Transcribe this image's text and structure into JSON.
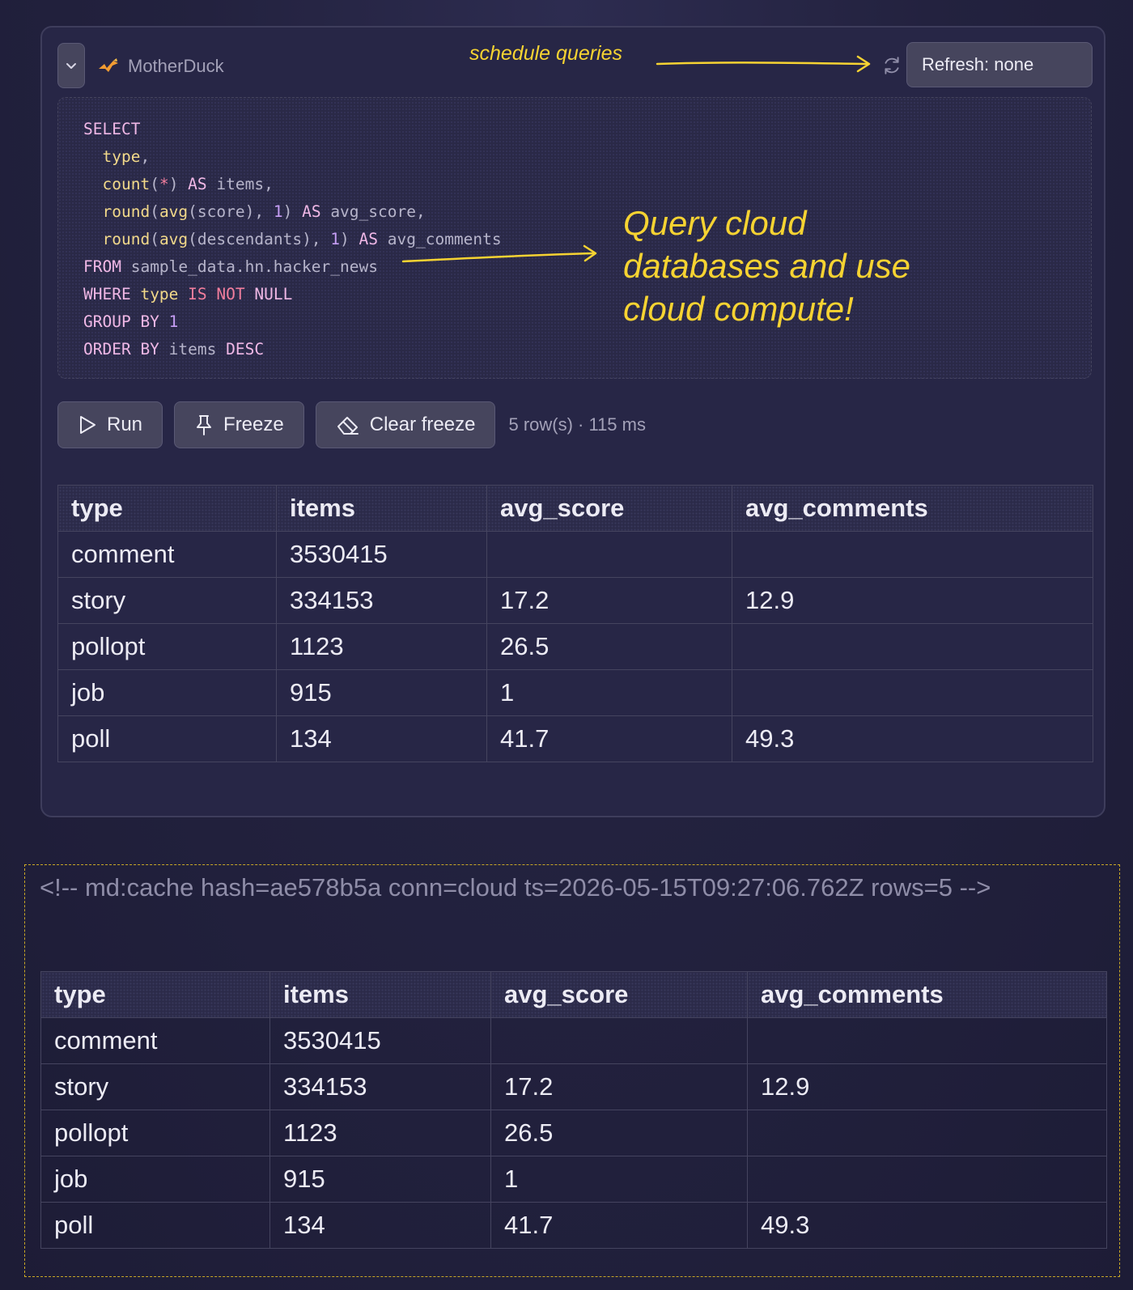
{
  "header": {
    "connection_name": "MotherDuck",
    "refresh_label": "Refresh: none",
    "annotation_schedule": "schedule queries"
  },
  "annotation_cloud": {
    "lines": [
      "Query cloud",
      "databases and use",
      "cloud compute!"
    ]
  },
  "toolbar": {
    "run_label": "Run",
    "freeze_label": "Freeze",
    "clear_freeze_label": "Clear freeze",
    "status": "5 row(s) · 115 ms"
  },
  "results": {
    "columns": [
      "type",
      "items",
      "avg_score",
      "avg_comments"
    ],
    "rows": [
      [
        "comment",
        "3530415",
        "",
        ""
      ],
      [
        "story",
        "334153",
        "17.2",
        "12.9"
      ],
      [
        "pollopt",
        "1123",
        "26.5",
        ""
      ],
      [
        "job",
        "915",
        "1",
        ""
      ],
      [
        "poll",
        "134",
        "41.7",
        "49.3"
      ]
    ]
  },
  "cache": {
    "comment": "<!-- md:cache hash=ae578b5a conn=cloud ts=2026-05-15T09:27:06.762Z rows=5 -->",
    "columns": [
      "type",
      "items",
      "avg_score",
      "avg_comments"
    ],
    "rows": [
      [
        "comment",
        "3530415",
        "",
        ""
      ],
      [
        "story",
        "334153",
        "17.2",
        "12.9"
      ],
      [
        "pollopt",
        "1123",
        "26.5",
        ""
      ],
      [
        "job",
        "915",
        "1",
        ""
      ],
      [
        "poll",
        "134",
        "41.7",
        "49.3"
      ]
    ]
  },
  "colors": {
    "annotation": "#f6d332",
    "background": "#23223f",
    "button": "#46455d"
  },
  "icons": {
    "collapse": "chevron-down-icon",
    "brand": "motherduck-logo-icon",
    "refresh": "refresh-icon",
    "run": "play-icon",
    "freeze": "pin-icon",
    "clear_freeze": "eraser-icon"
  }
}
